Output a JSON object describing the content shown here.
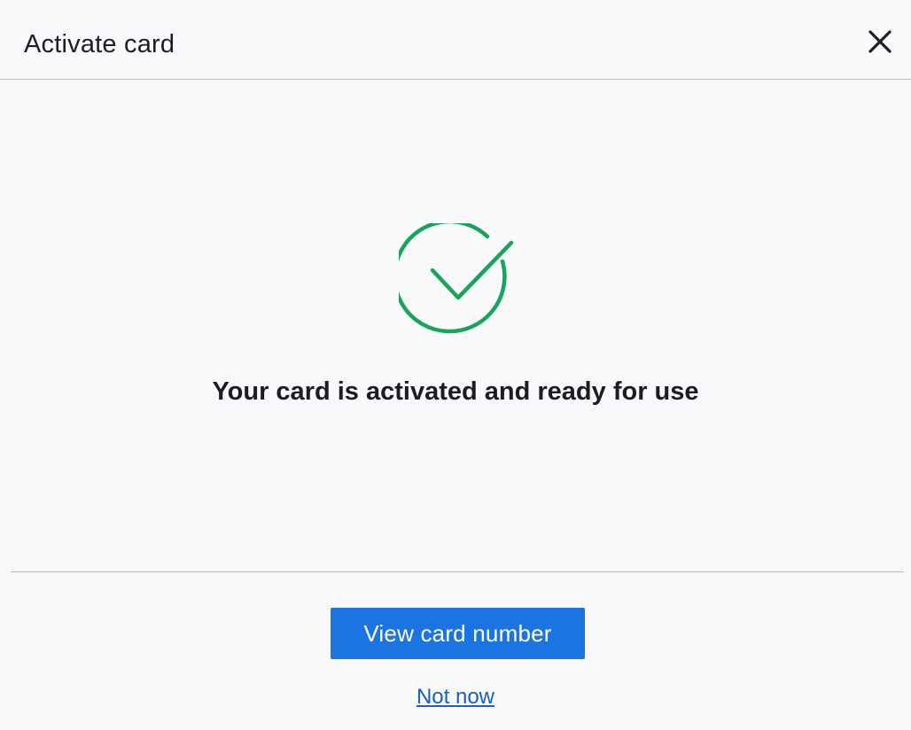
{
  "dialog": {
    "title": "Activate card",
    "close_icon": "close-icon"
  },
  "status": {
    "icon": "check-circle-icon",
    "icon_color": "#1aa45b",
    "message": "Your card is activated and ready for use"
  },
  "actions": {
    "primary_label": "View card number",
    "primary_color": "#1b74e0",
    "secondary_label": "Not now"
  }
}
